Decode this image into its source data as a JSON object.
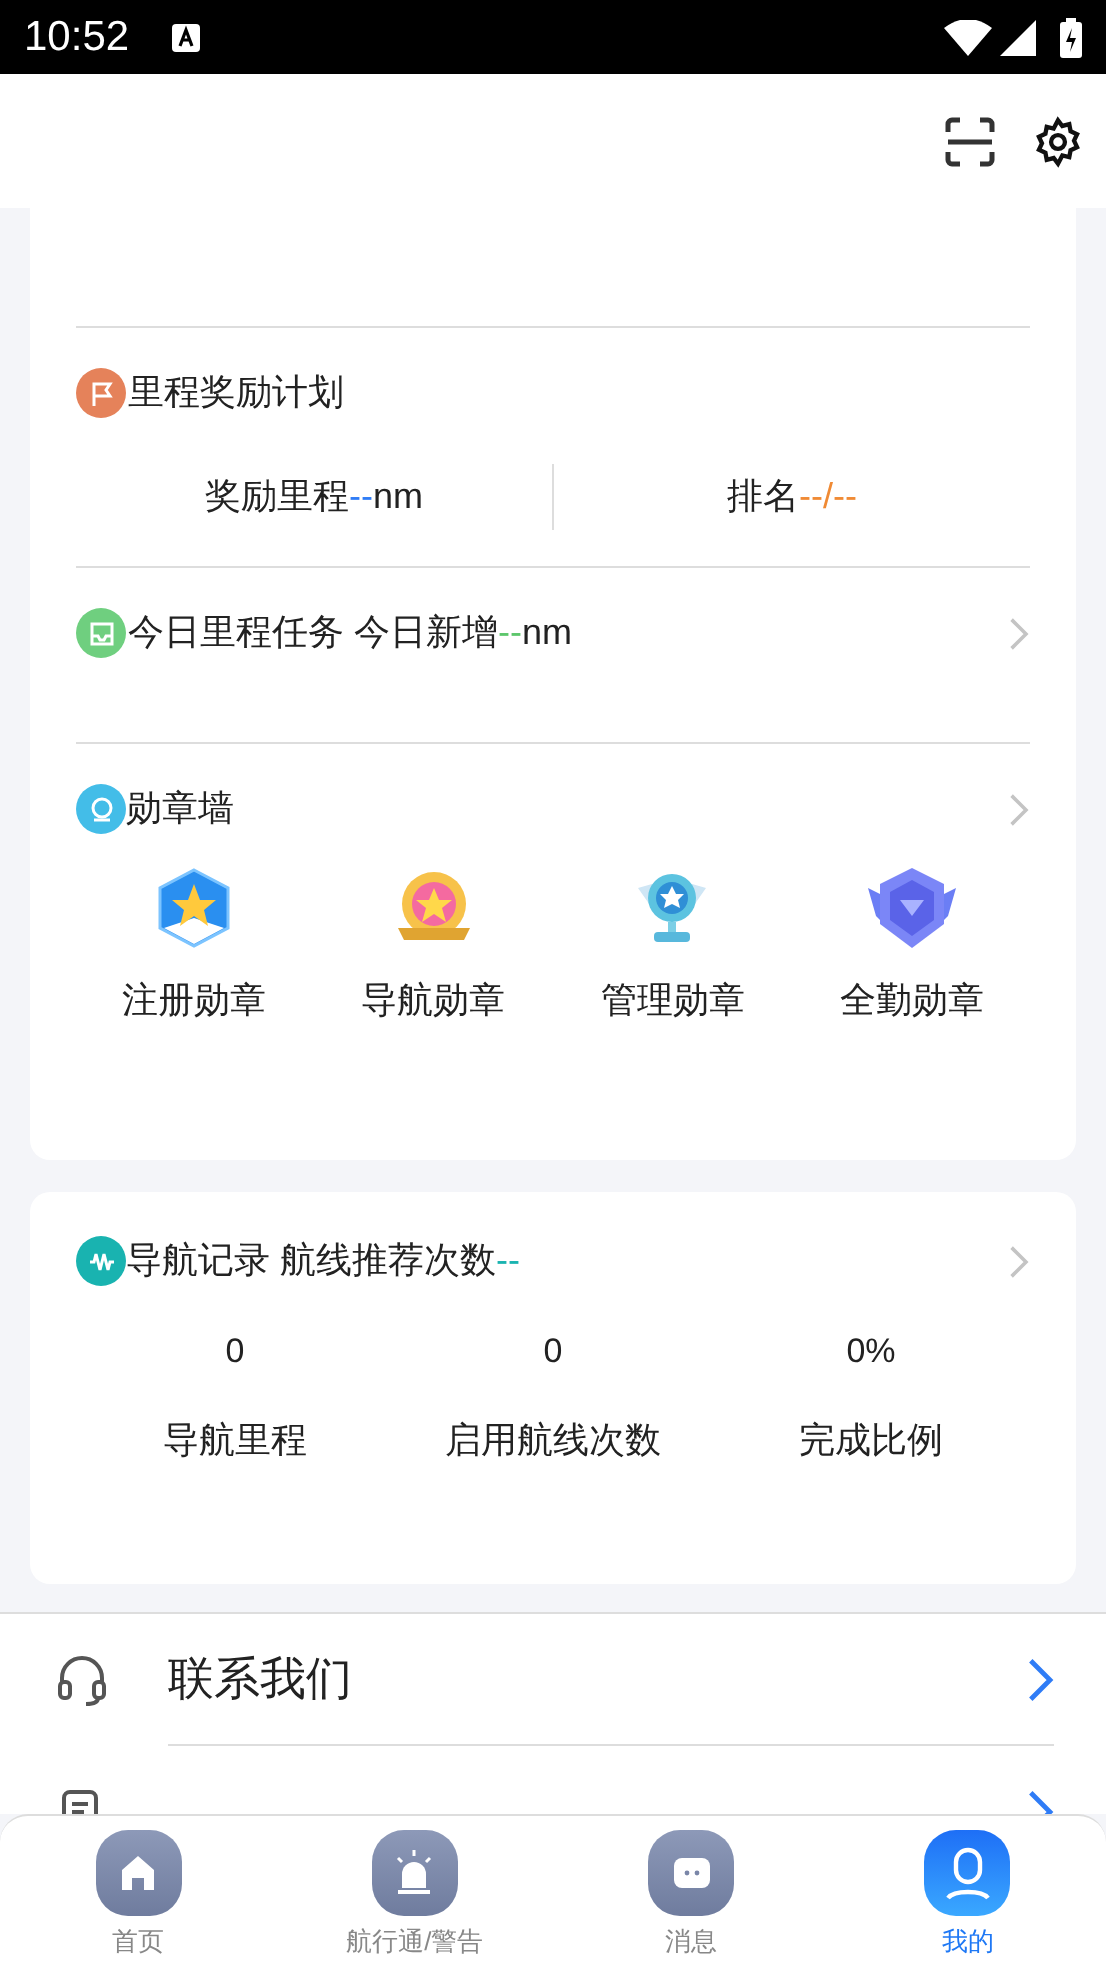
{
  "status_bar": {
    "time": "10:52"
  },
  "mileage_plan": {
    "title": "里程奖励计划",
    "stats": [
      {
        "label": "奖励里程",
        "value": "--",
        "unit": "nm",
        "color": "#2f7cf6"
      },
      {
        "label": "排名",
        "value": "--/--",
        "color": "#f08a34"
      }
    ]
  },
  "daily_task": {
    "title": "今日里程任务 今日新增",
    "value": "--",
    "unit": "nm",
    "color": "#5cc66b"
  },
  "medal_wall": {
    "title": "勋章墙",
    "medals": [
      {
        "kind": "register",
        "label": "注册勋章"
      },
      {
        "kind": "navigation",
        "label": "导航勋章"
      },
      {
        "kind": "management",
        "label": "管理勋章"
      },
      {
        "kind": "attendance",
        "label": "全勤勋章"
      }
    ]
  },
  "nav_record": {
    "title": "导航记录 航线推荐次数",
    "value": "--",
    "color": "#19b3b0",
    "stats": [
      {
        "value": "0",
        "label": "导航里程"
      },
      {
        "value": "0",
        "label": "启用航线次数"
      },
      {
        "value": "0%",
        "label": "完成比例"
      }
    ]
  },
  "menu": [
    {
      "kind": "headset",
      "label": "联系我们"
    },
    {
      "kind": "feedback"
    }
  ],
  "tab_bar": [
    {
      "kind": "home",
      "label": "首页",
      "selected": false
    },
    {
      "kind": "alarm",
      "label": "航行通/警告",
      "selected": false
    },
    {
      "kind": "message",
      "label": "消息",
      "selected": false
    },
    {
      "kind": "profile",
      "label": "我的",
      "selected": true
    }
  ]
}
